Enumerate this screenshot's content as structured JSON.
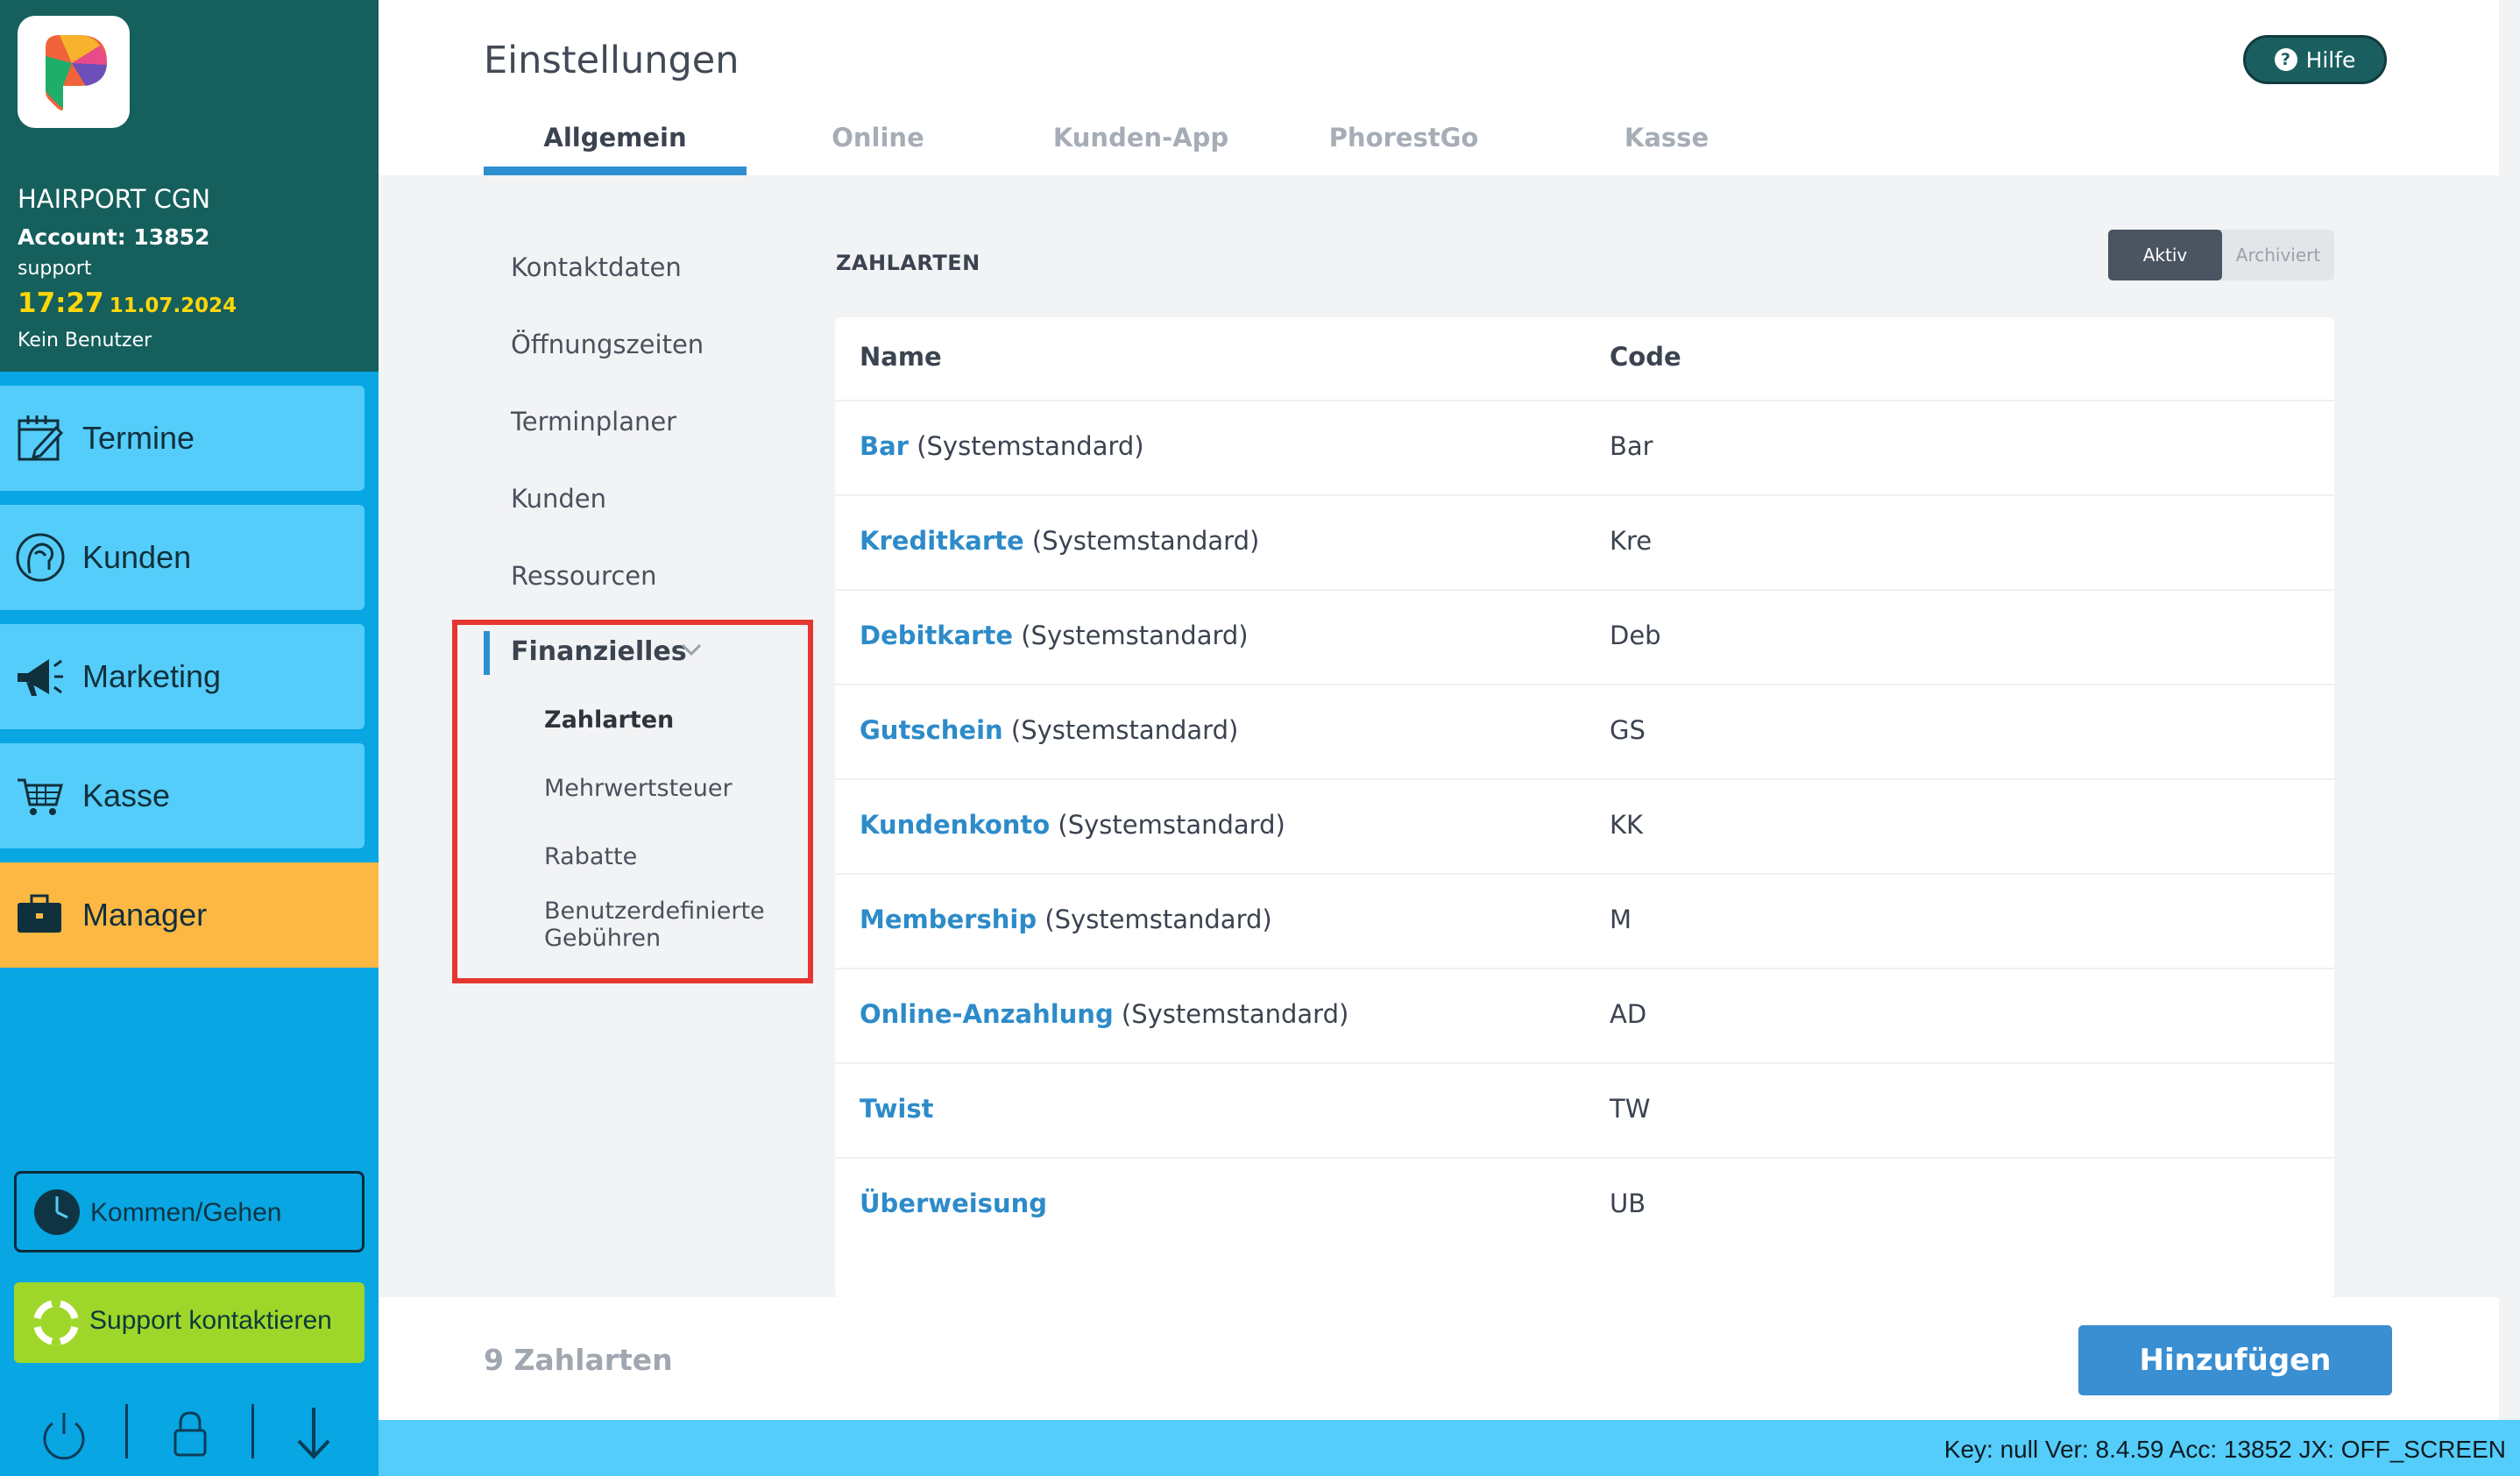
{
  "app": {
    "account_name": "HAIRPORT CGN",
    "account_number": "Account: 13852",
    "user": "support",
    "time": "17:27",
    "date": "11.07.2024",
    "no_user": "Kein Benutzer"
  },
  "nav": {
    "items": [
      {
        "label": "Termine",
        "icon": "calendar-edit-icon"
      },
      {
        "label": "Kunden",
        "icon": "customer-head-icon"
      },
      {
        "label": "Marketing",
        "icon": "megaphone-icon"
      },
      {
        "label": "Kasse",
        "icon": "cart-icon"
      },
      {
        "label": "Manager",
        "icon": "briefcase-icon"
      }
    ],
    "kommen_gehen": "Kommen/Gehen",
    "support": "Support kontaktieren"
  },
  "header": {
    "title": "Einstellungen",
    "help": "Hilfe",
    "tabs": [
      "Allgemein",
      "Online",
      "Kunden-App",
      "PhorestGo",
      "Kasse"
    ],
    "active_tab": "Allgemein"
  },
  "subnav": {
    "items": [
      "Kontaktdaten",
      "Öffnungszeiten",
      "Terminplaner",
      "Kunden",
      "Ressourcen"
    ],
    "finanzielles": {
      "label": "Finanzielles",
      "items": [
        "Zahlarten",
        "Mehrwertsteuer",
        "Rabatte",
        "Benutzerdefinierte",
        "Gebühren"
      ]
    }
  },
  "zahlarten": {
    "title": "ZAHLARTEN",
    "filter_active": "Aktiv",
    "filter_archived": "Archiviert",
    "col_name": "Name",
    "col_code": "Code",
    "rows": [
      {
        "name": "Bar",
        "suffix": "(Systemstandard)",
        "code": "Bar"
      },
      {
        "name": "Kreditkarte",
        "suffix": "(Systemstandard)",
        "code": "Kre"
      },
      {
        "name": "Debitkarte",
        "suffix": "(Systemstandard)",
        "code": "Deb"
      },
      {
        "name": "Gutschein",
        "suffix": "(Systemstandard)",
        "code": "GS"
      },
      {
        "name": "Kundenkonto",
        "suffix": "(Systemstandard)",
        "code": "KK"
      },
      {
        "name": "Membership",
        "suffix": "(Systemstandard)",
        "code": "M"
      },
      {
        "name": "Online-Anzahlung",
        "suffix": "(Systemstandard)",
        "code": "AD"
      },
      {
        "name": "Twist",
        "suffix": "",
        "code": "TW"
      },
      {
        "name": "Überweisung",
        "suffix": "",
        "code": "UB"
      }
    ]
  },
  "footer": {
    "count": "9 Zahlarten",
    "add": "Hinzufügen"
  },
  "status": "Key: null Ver: 8.4.59 Acc: 13852  JX: OFF_SCREEN",
  "colors": {
    "sidebar_top": "#155f5c",
    "sidebar": "#08a6e3",
    "nav_button": "#55cdfa",
    "nav_active": "#fdb843",
    "accent": "#2d8fd0",
    "highlight_box": "#e5372f"
  }
}
